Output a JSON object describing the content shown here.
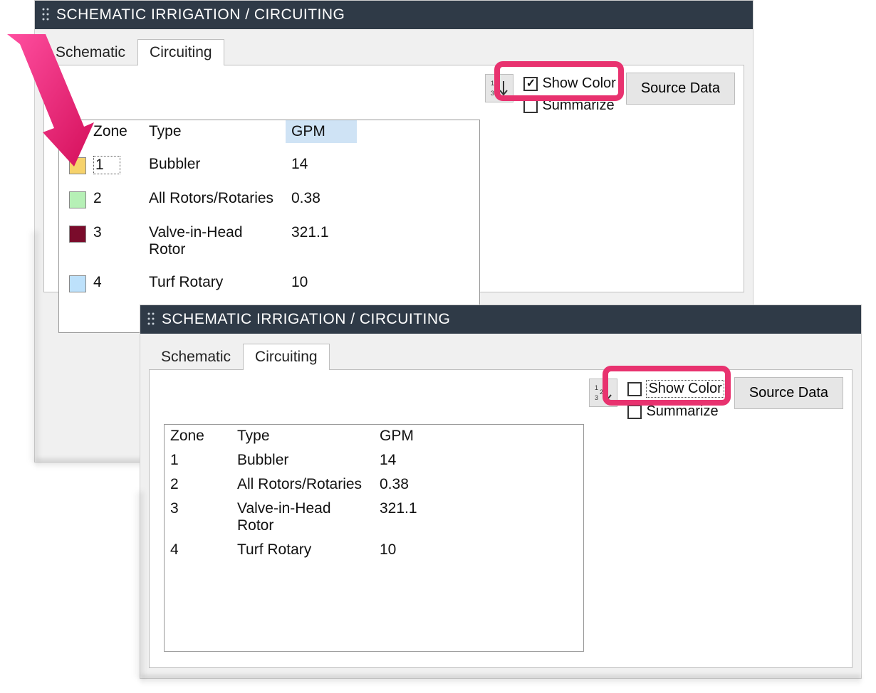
{
  "title": "SCHEMATIC IRRIGATION / CIRCUITING",
  "tabs": {
    "schematic": "Schematic",
    "circuiting": "Circuiting"
  },
  "checkboxes": {
    "showcolor": "Show Color",
    "summarize": "Summarize"
  },
  "buttons": {
    "sourcedata": "Source Data"
  },
  "table": {
    "headers": {
      "zone": "Zone",
      "type": "Type",
      "gpm": "GPM"
    },
    "rows": [
      {
        "zone": "1",
        "type": "Bubbler",
        "gpm": "14",
        "color": "#f6d26b"
      },
      {
        "zone": "2",
        "type": "All Rotors/Rotaries",
        "gpm": "0.38",
        "color": "#b6f0b6"
      },
      {
        "zone": "3",
        "type": "Valve-in-Head Rotor",
        "gpm": "321.1",
        "color": "#7a0b2b"
      },
      {
        "zone": "4",
        "type": "Turf Rotary",
        "gpm": "10",
        "color": "#bde1fb"
      }
    ]
  }
}
